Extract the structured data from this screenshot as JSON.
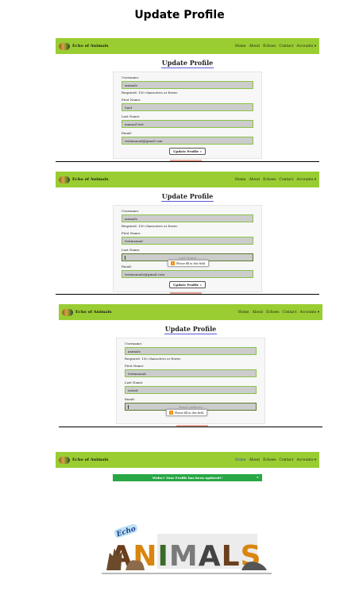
{
  "page": {
    "title": "Update Profile"
  },
  "navbar": {
    "brand": "Echo of Animals",
    "links": [
      "Home",
      "About",
      "Echoes",
      "Contact",
      "Accounts ▾"
    ]
  },
  "form": {
    "title": "Update Profile",
    "username_label": "Username:",
    "username_help": "Required. 150 characters or fewer.",
    "first_name_label": "First Name:",
    "last_name_label": "Last Name:",
    "email_label": "Email:",
    "submit_label": "Update Profile »",
    "validation_message": "Please fill in this field."
  },
  "shots": [
    {
      "username": "animals",
      "first_name": "Saul",
      "last_name": "manual test",
      "email": "testmanual@gmail.com"
    },
    {
      "username": "animals",
      "first_name": "testmanual",
      "last_name": "",
      "last_name_placeholder": "Last Name",
      "email": "testmanualo@gmail.com"
    },
    {
      "username": "animals",
      "first_name": "testmanual",
      "last_name": "tested",
      "email": "",
      "email_placeholder": "Email Address"
    }
  ],
  "success": {
    "message": "Woho!! Your Profile has been updated!!",
    "close": "×"
  },
  "logo": {
    "text_small": "Echo",
    "text_large": "ANIMALS",
    "text_large_colors": [
      "#6b3e1c",
      "#d8860f",
      "#3b6b2a",
      "#7a7a7a",
      "#444444"
    ]
  }
}
